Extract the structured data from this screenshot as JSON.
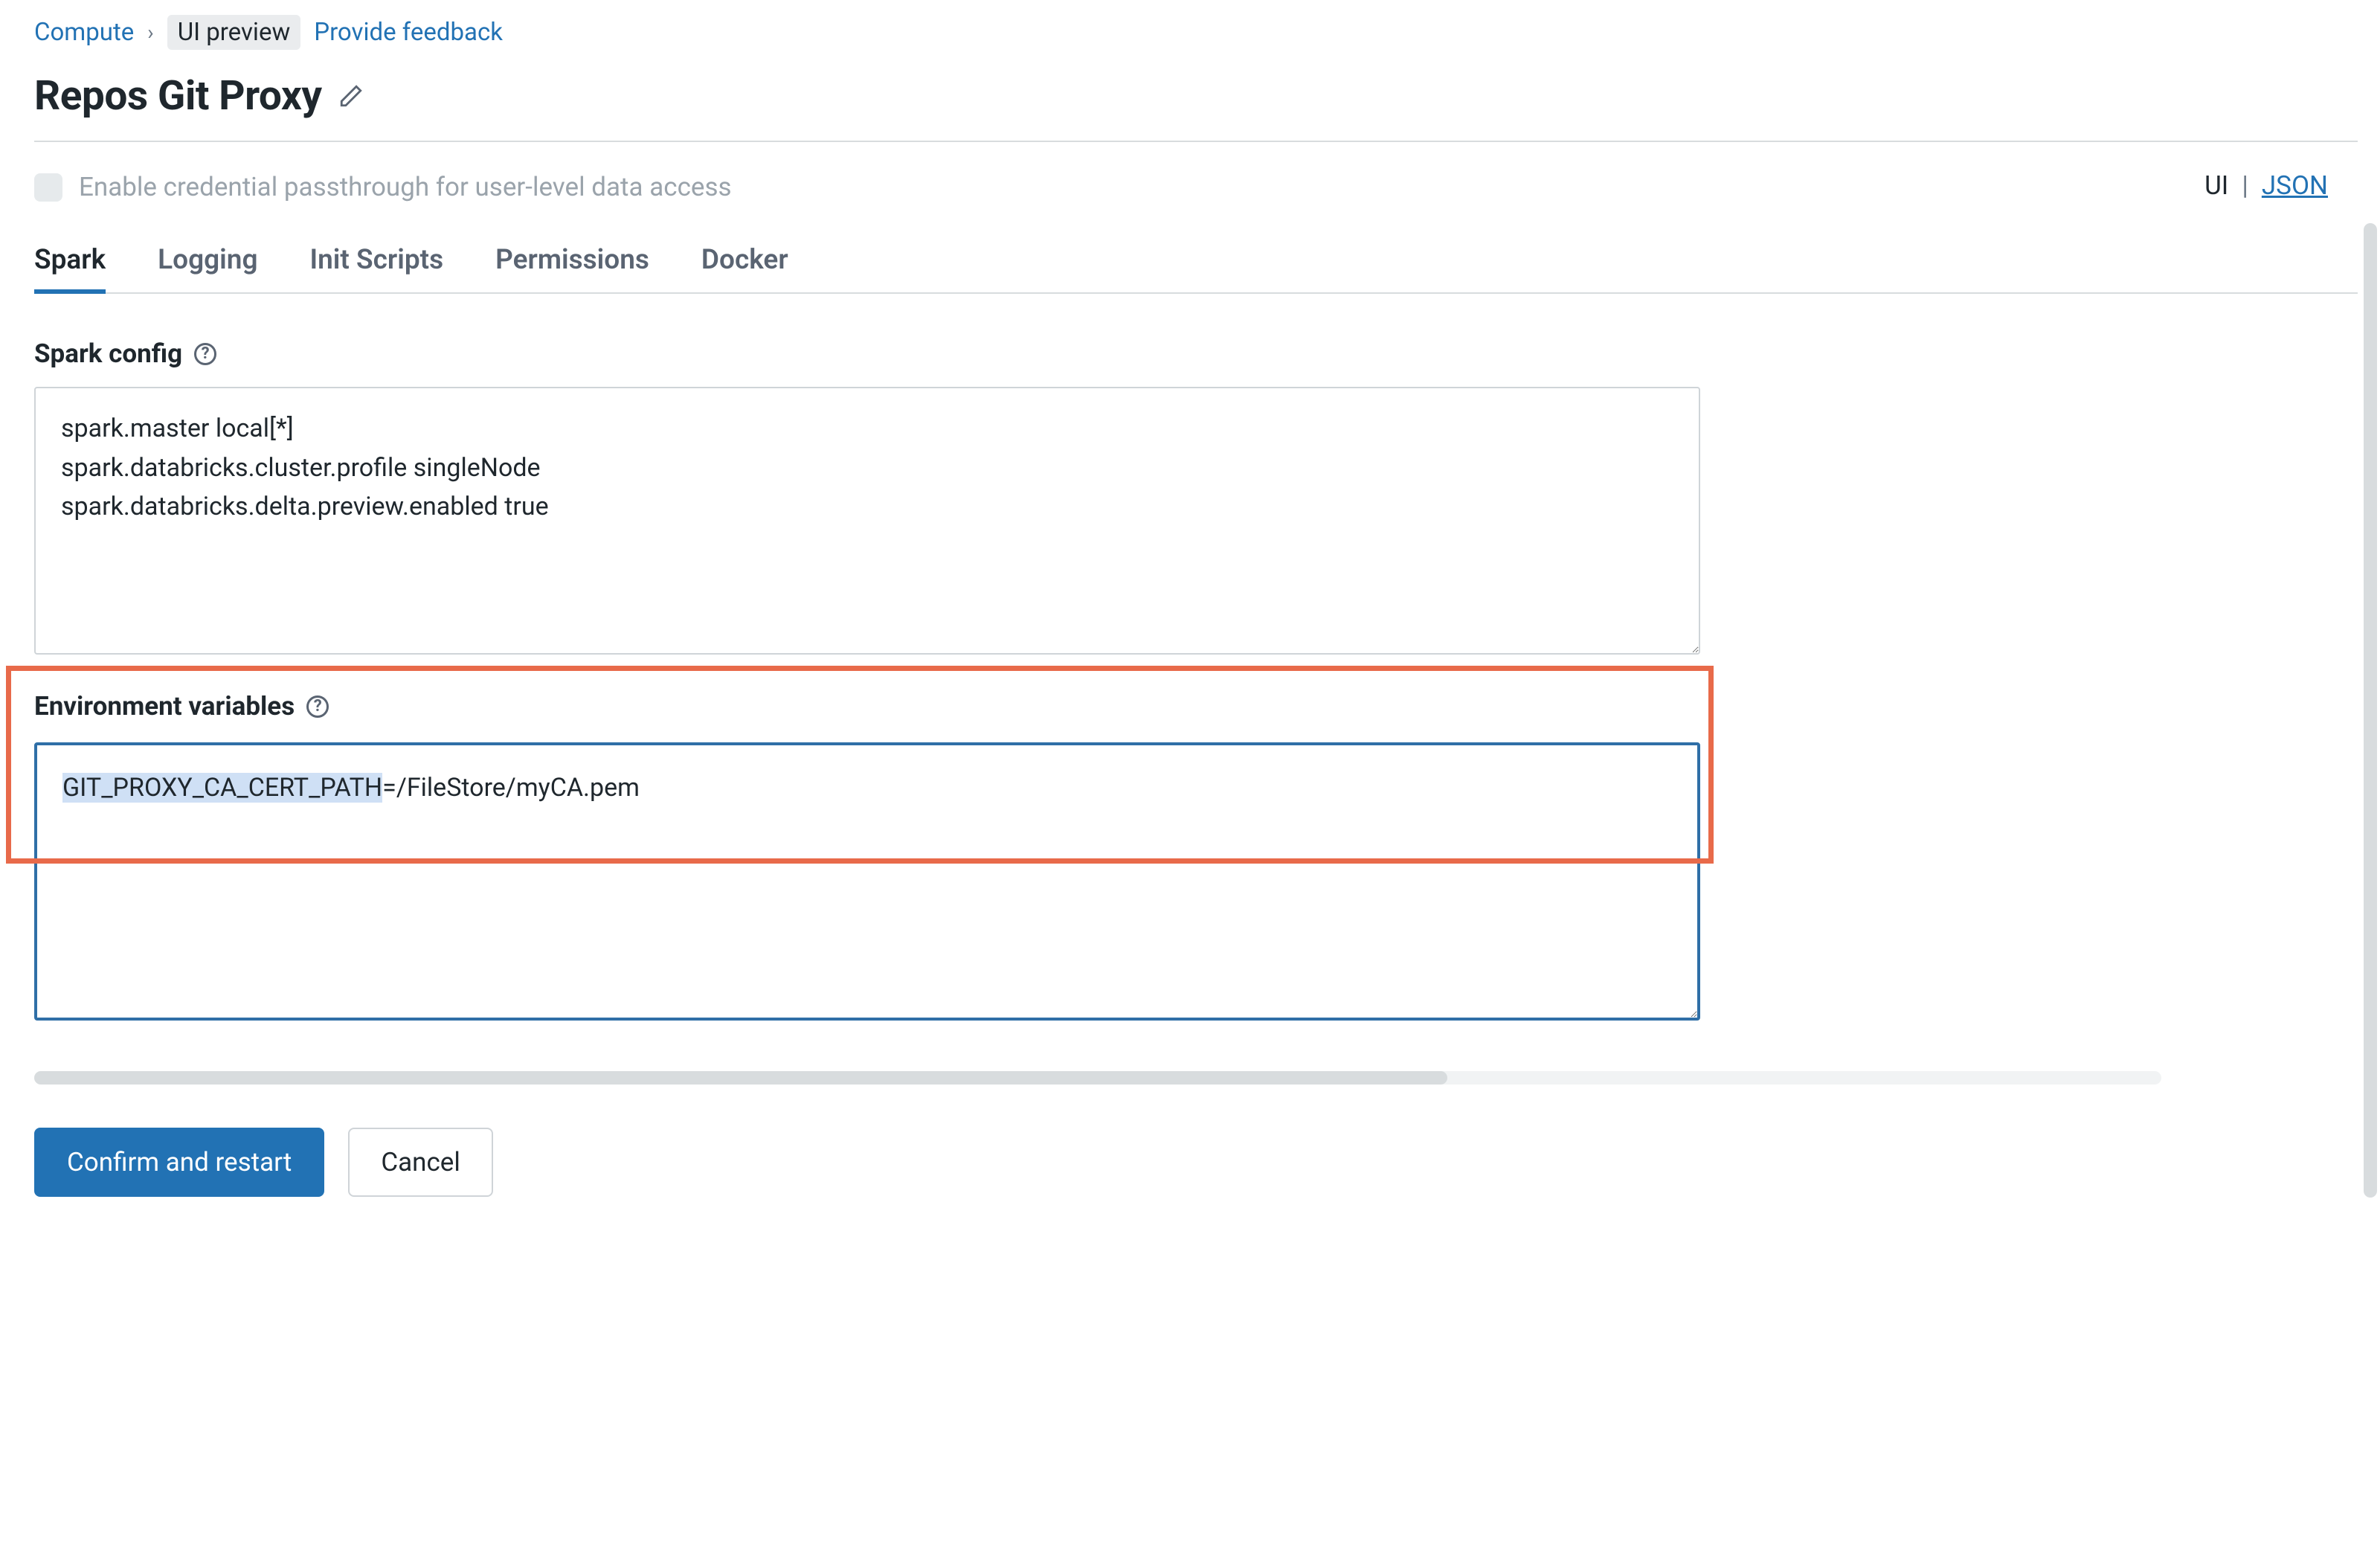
{
  "breadcrumb": {
    "root": "Compute",
    "current": "UI preview",
    "feedback": "Provide feedback"
  },
  "title": "Repos Git Proxy",
  "passthrough_label": "Enable credential passthrough for user-level data access",
  "view_toggle": {
    "ui": "UI",
    "json": "JSON",
    "sep": "|"
  },
  "tabs": [
    "Spark",
    "Logging",
    "Init Scripts",
    "Permissions",
    "Docker"
  ],
  "active_tab": "Spark",
  "spark": {
    "label": "Spark config",
    "value": "spark.master local[*]\nspark.databricks.cluster.profile singleNode\nspark.databricks.delta.preview.enabled true"
  },
  "env": {
    "label": "Environment variables",
    "selected_prefix": "GIT_PROXY_CA_CERT_PATH",
    "rest": "=/FileStore/myCA.pem"
  },
  "buttons": {
    "confirm": "Confirm and restart",
    "cancel": "Cancel"
  },
  "help_glyph": "?"
}
